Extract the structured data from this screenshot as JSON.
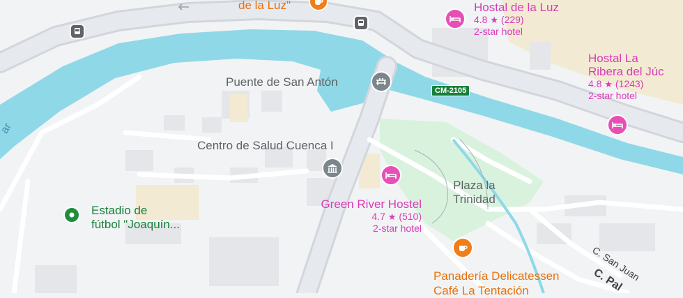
{
  "map": {
    "colors": {
      "background": "#f1f3f4",
      "water": "#8fd8e8",
      "road": "#ffffff",
      "major_road": "#dfe3e8",
      "park": "#d8f2dd",
      "building": "#e6e8eb",
      "hotel": "#d93bb6",
      "food": "#e8710a",
      "road_badge": "#188038"
    }
  },
  "labels": {
    "top_partial": "de la Luz\"",
    "bridge": "Puente de San Antón",
    "health_center": "Centro de Salud Cuenca I",
    "stadium_line1": "Estadio de",
    "stadium_line2": "fútbol \"Joaquín...",
    "plaza_line1": "Plaza la",
    "plaza_line2": "Trinidad",
    "street_san_juan": "C. San Juan",
    "street_pal": "C. Pal",
    "road_badge": "CM-2105",
    "river_fragment": "ar"
  },
  "hotels": [
    {
      "name_lines": [
        "Hostal de la Luz"
      ],
      "rating": "4.8",
      "reviews": "(229)",
      "category": "2-star hotel"
    },
    {
      "name_lines": [
        "Hostal La",
        "Ribera del Júc"
      ],
      "rating": "4.8",
      "reviews": "(1243)",
      "category": "2-star hotel"
    },
    {
      "name_lines": [
        "Green River Hostel"
      ],
      "rating": "4.7",
      "reviews": "(510)",
      "category": "2-star hotel"
    }
  ],
  "cafe": {
    "line1": "Panadería Delicatessen",
    "line2": "Café La Tentación"
  },
  "icons": {
    "hotel": "bed-icon",
    "health": "bank-building-icon",
    "bridge": "bridge-icon",
    "cafe": "coffee-cup-icon",
    "stadium": "map-pin-icon",
    "bus": "bus-icon",
    "arrow": "one-way-arrow-icon"
  }
}
